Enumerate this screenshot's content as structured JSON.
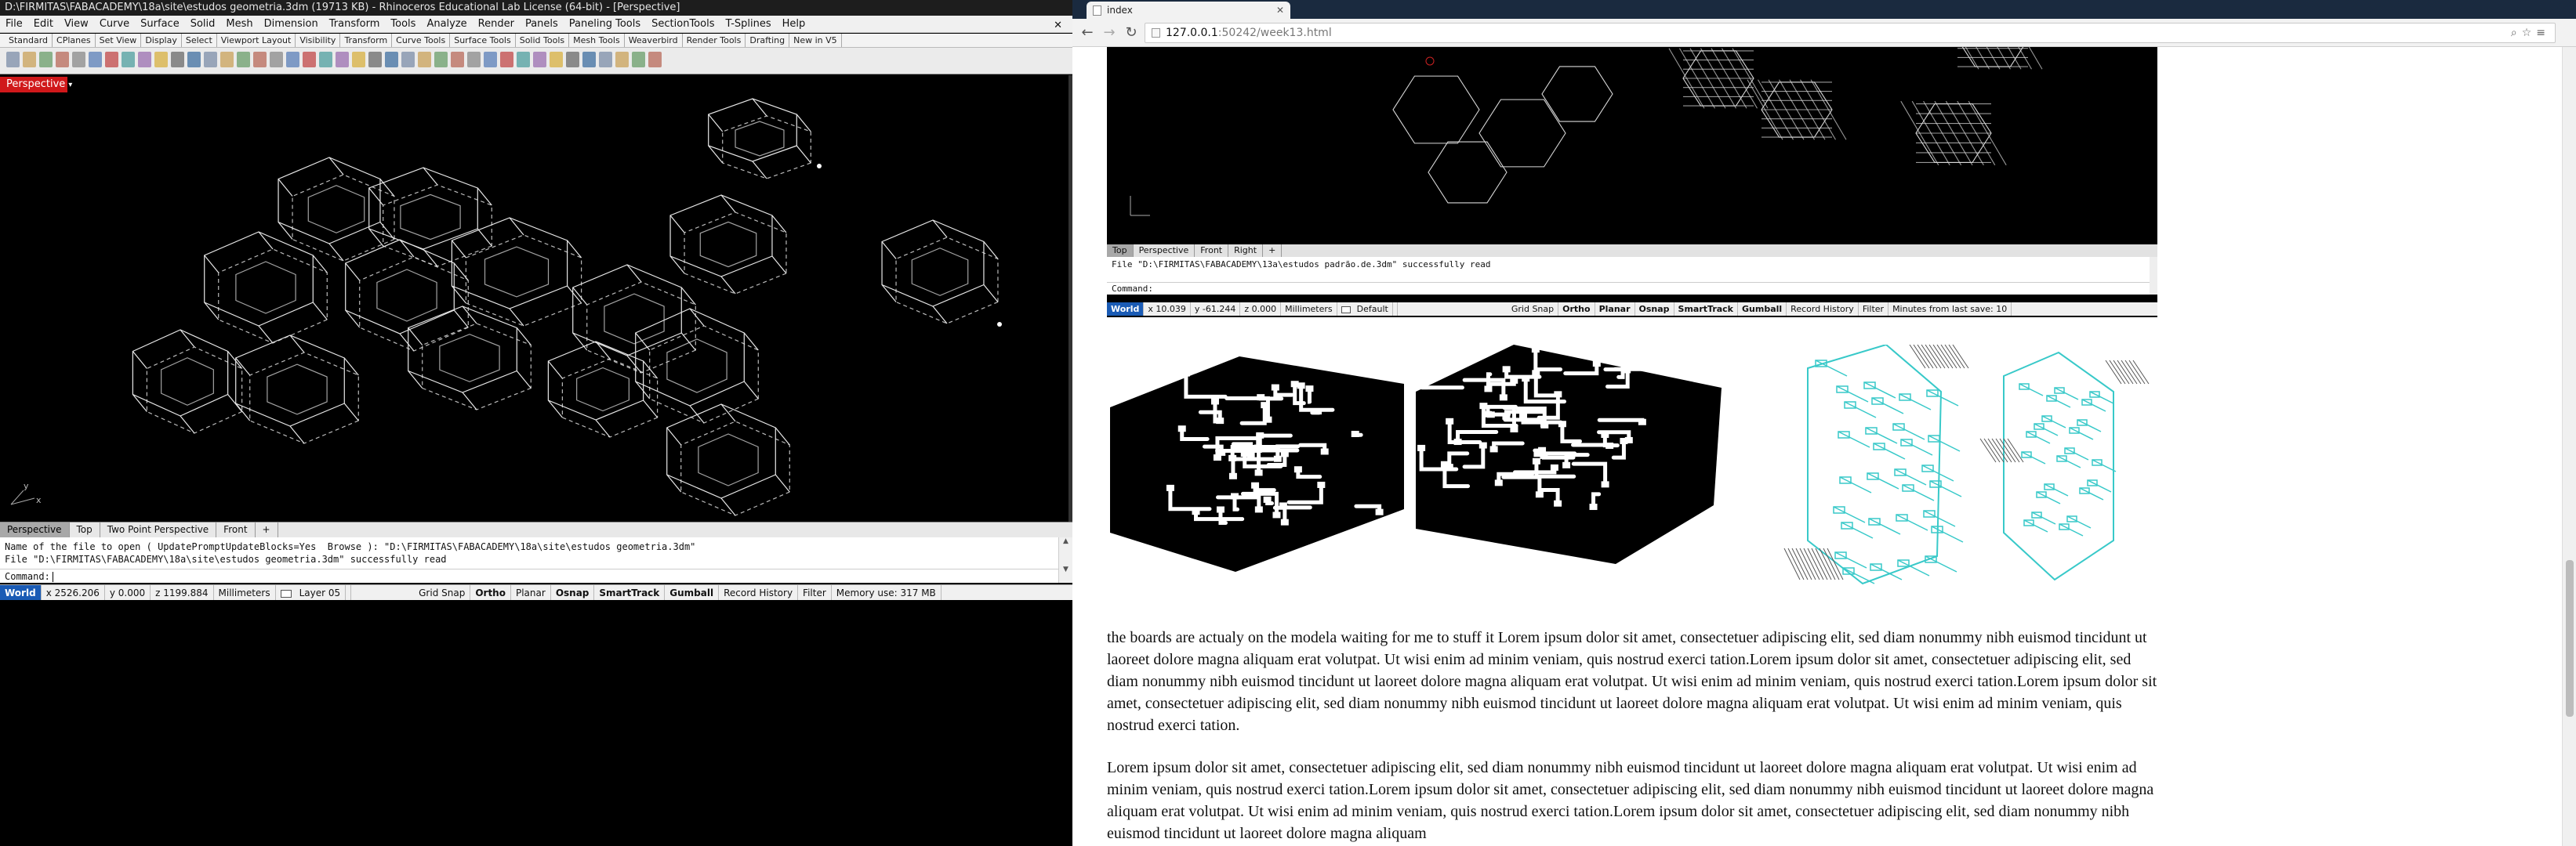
{
  "rhino": {
    "title": "D:\\FIRMITAS\\FABACADEMY\\18a\\site\\estudos geometria.3dm (19713 KB) - Rhinoceros Educational Lab License (64-bit) - [Perspective]",
    "menu": [
      "File",
      "Edit",
      "View",
      "Curve",
      "Surface",
      "Solid",
      "Mesh",
      "Dimension",
      "Transform",
      "Tools",
      "Analyze",
      "Render",
      "Panels",
      "Paneling Tools",
      "SectionTools",
      "T-Splines",
      "Help"
    ],
    "toolbar_tabs": [
      "Standard",
      "CPlanes",
      "Set View",
      "Display",
      "Select",
      "Viewport Layout",
      "Visibility",
      "Transform",
      "Curve Tools",
      "Surface Tools",
      "Solid Tools",
      "Mesh Tools",
      "Weaverbird",
      "Render Tools",
      "Drafting",
      "New in V5"
    ],
    "viewport_label": "Perspective",
    "axis_x": "x",
    "axis_y": "y",
    "viewport_tabs": [
      "Perspective",
      "Top",
      "Two Point Perspective",
      "Front",
      "+"
    ],
    "command_history": [
      "Name of the file to open ( UpdatePromptUpdateBlocks=Yes  Browse ): \"D:\\FIRMITAS\\FABACADEMY\\18a\\site\\estudos geometria.3dm\"",
      "File \"D:\\FIRMITAS\\FABACADEMY\\18a\\site\\estudos geometria.3dm\" successfully read"
    ],
    "command_prompt": "Command:",
    "status": {
      "cplane": "World",
      "x": "x 2526.206",
      "y": "y 0.000",
      "z": "z 1199.884",
      "units": "Millimeters",
      "layer": "Layer 05",
      "grid_snap": "Grid Snap",
      "ortho": "Ortho",
      "planar": "Planar",
      "osnap": "Osnap",
      "smarttrack": "SmartTrack",
      "gumball": "Gumball",
      "record_history": "Record History",
      "filter": "Filter",
      "memory": "Memory use: 317 MB"
    }
  },
  "browser": {
    "tab_title": "index",
    "tab2": "",
    "url_host": "127.0.0.1",
    "url_path": ":50242/week13.html",
    "embedded": {
      "tabs": [
        "Top",
        "Perspective",
        "Front",
        "Right",
        "+"
      ],
      "history": "File \"D:\\FIRMITAS\\FABACADEMY\\13a\\estudos padrão.de.3dm\" successfully read",
      "prompt": "Command:",
      "status": {
        "cplane": "World",
        "x": "x 10.039",
        "y": "y -61.244",
        "z": "z 0.000",
        "units": "Millimeters",
        "layer": "Default",
        "grid_snap": "Grid Snap",
        "ortho": "Ortho",
        "planar": "Planar",
        "osnap": "Osnap",
        "smarttrack": "SmartTrack",
        "gumball": "Gumball",
        "record_history": "Record History",
        "filter": "Filter",
        "save": "Minutes from last save: 10"
      }
    },
    "paragraph1": "the boards are actualy on the modela waiting for me to stuff it Lorem ipsum dolor sit amet, consectetuer adipiscing elit, sed diam nonummy nibh euismod tincidunt ut laoreet dolore magna aliquam erat volutpat. Ut wisi enim ad minim veniam, quis nostrud exerci tation.Lorem ipsum dolor sit amet, consectetuer adipiscing elit, sed diam nonummy nibh euismod tincidunt ut laoreet dolore magna aliquam erat volutpat. Ut wisi enim ad minim veniam, quis nostrud exerci tation.Lorem ipsum dolor sit amet, consectetuer adipiscing elit, sed diam nonummy nibh euismod tincidunt ut laoreet dolore magna aliquam erat volutpat. Ut wisi enim ad minim veniam, quis nostrud exerci tation.",
    "paragraph2": "Lorem ipsum dolor sit amet, consectetuer adipiscing elit, sed diam nonummy nibh euismod tincidunt ut laoreet dolore magna aliquam erat volutpat. Ut wisi enim ad minim veniam, quis nostrud exerci tation.Lorem ipsum dolor sit amet, consectetuer adipiscing elit, sed diam nonummy nibh euismod tincidunt ut laoreet dolore magna aliquam erat volutpat. Ut wisi enim ad minim veniam, quis nostrud exerci tation.Lorem ipsum dolor sit amet, consectetuer adipiscing elit, sed diam nonummy nibh euismod tincidunt ut laoreet dolore magna aliquam"
  },
  "colors": {
    "viewport_label": "#d0181a",
    "world": "#1a5bb5",
    "pcb_cyan": "#38c9c9",
    "wireframe": "#e8e8e8"
  },
  "icons": [
    "back-arrow-icon",
    "forward-arrow-icon",
    "reload-icon",
    "page-icon",
    "zoom-icon",
    "star-icon",
    "menu-icon",
    "close-icon"
  ]
}
